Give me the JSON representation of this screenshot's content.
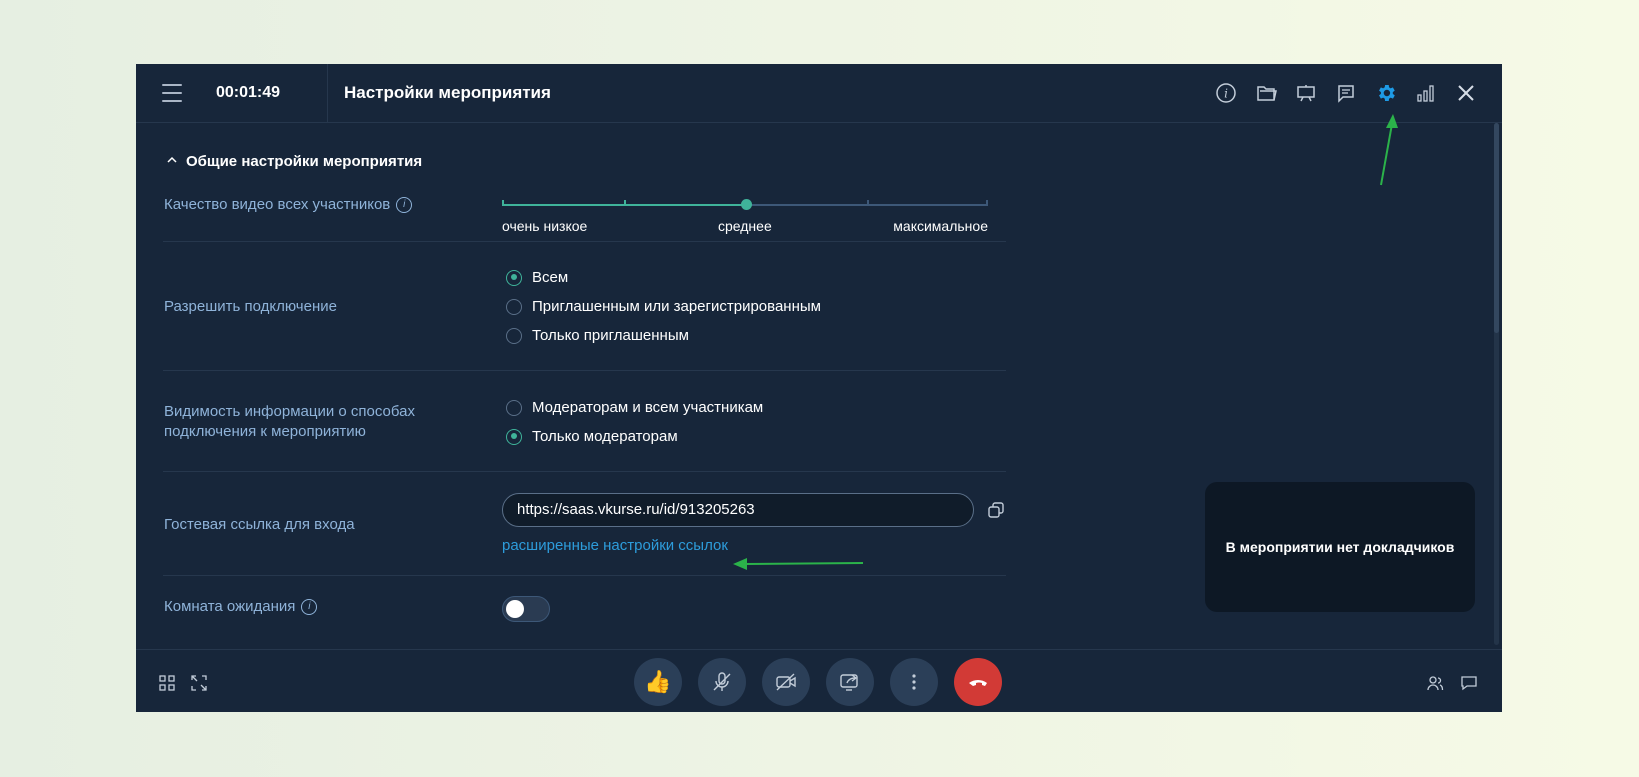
{
  "header": {
    "timer": "00:01:49",
    "title": "Настройки мероприятия",
    "icons": [
      "info-icon",
      "folder-icon",
      "presentation-icon",
      "notes-icon",
      "settings-icon",
      "signal-icon",
      "close-icon"
    ]
  },
  "section": {
    "title": "Общие настройки мероприятия"
  },
  "video_quality": {
    "label": "Качество видео всех участников",
    "options": [
      "очень низкое",
      "среднее",
      "максимальное"
    ],
    "selected": "среднее"
  },
  "allow_connection": {
    "label": "Разрешить подключение",
    "options": [
      "Всем",
      "Приглашенным или зарегистрированным",
      "Только приглашенным"
    ],
    "selected": "Всем"
  },
  "visibility": {
    "label_line1": "Видимость информации о способах",
    "label_line2": "подключения к мероприятию",
    "options": [
      "Модераторам и всем участникам",
      "Только модераторам"
    ],
    "selected": "Только модераторам"
  },
  "guest_link": {
    "label": "Гостевая ссылка для входа",
    "value": "https://saas.vkurse.ru/id/913205263",
    "advanced_link": "расширенные настройки ссылок"
  },
  "waiting_room": {
    "label": "Комната ожидания",
    "enabled": false
  },
  "speakers_panel": {
    "text": "В мероприятии нет докладчиков"
  },
  "colors": {
    "background": "#17263a",
    "accent_green": "#3fb39a",
    "link_blue": "#2d9cdb",
    "settings_active": "#1e9be6",
    "end_call": "#d23a36",
    "annotation_arrow": "#2bb34a"
  }
}
